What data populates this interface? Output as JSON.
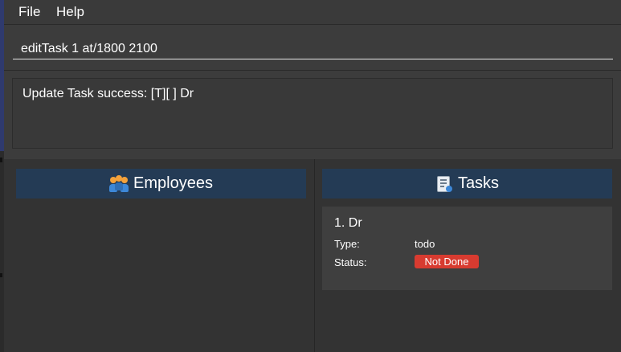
{
  "menu": {
    "file": "File",
    "help": "Help"
  },
  "command": {
    "value": "editTask 1 at/1800 2100"
  },
  "result": {
    "text": "Update Task success: [T][ ] Dr"
  },
  "employees_panel": {
    "title": "Employees",
    "icon": "employees-icon"
  },
  "tasks_panel": {
    "title": "Tasks",
    "icon": "task-list-icon",
    "items": [
      {
        "title": "1.  Dr",
        "type_label": "Type:",
        "type_value": "todo",
        "status_label": "Status:",
        "status_value": "Not Done"
      }
    ]
  },
  "colors": {
    "panel_header": "#243b55",
    "status_not_done": "#d83b30",
    "background": "#3c3c3c"
  }
}
